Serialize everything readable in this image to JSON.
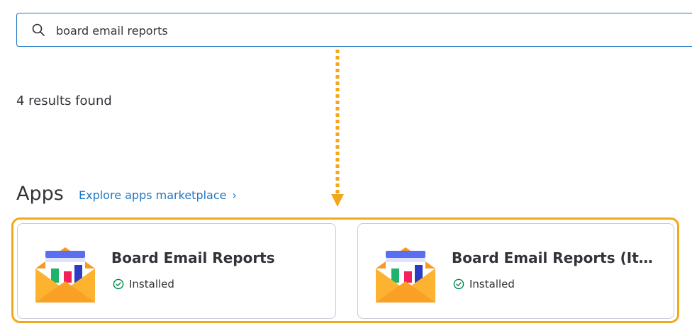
{
  "search": {
    "value": "board email reports",
    "placeholder": "Search"
  },
  "results": {
    "summary": "4 results found"
  },
  "apps_section": {
    "title": "Apps",
    "explore_link": "Explore apps marketplace",
    "explore_chevron": "›"
  },
  "apps": [
    {
      "name": "Board Email Reports",
      "status": "Installed"
    },
    {
      "name": "Board Email Reports (Item View)",
      "status": "Installed"
    }
  ],
  "colors": {
    "accent_link": "#1f76c2",
    "highlight": "#f2a81d",
    "status_ok": "#00854d"
  },
  "icons": {
    "search": "search-icon",
    "app_logo": "envelope-report-icon",
    "installed": "check-circle-icon",
    "annotation_arrow": "dotted-arrow-down-icon"
  }
}
